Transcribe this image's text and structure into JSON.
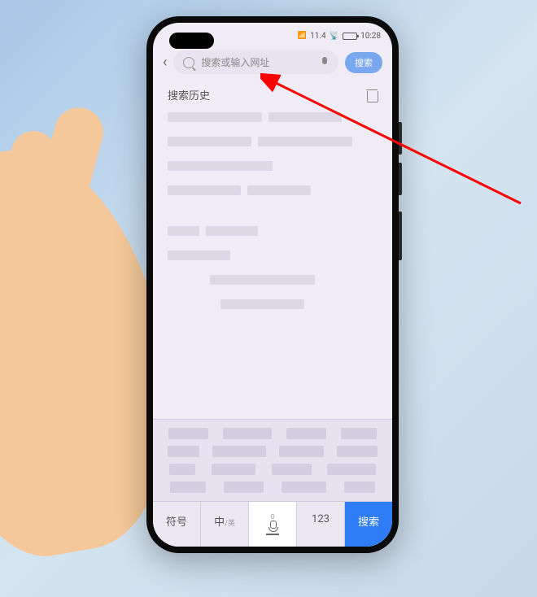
{
  "status_bar": {
    "time": "10:28",
    "signal_label": "11.4"
  },
  "search": {
    "placeholder": "搜索或输入网址",
    "button_label": "搜索"
  },
  "history": {
    "title": "搜索历史"
  },
  "keyboard": {
    "symbol_key": "符号",
    "lang_key": "中",
    "lang_sub": "/英",
    "number_key": "123",
    "search_key": "搜索",
    "voice_label": "0"
  }
}
